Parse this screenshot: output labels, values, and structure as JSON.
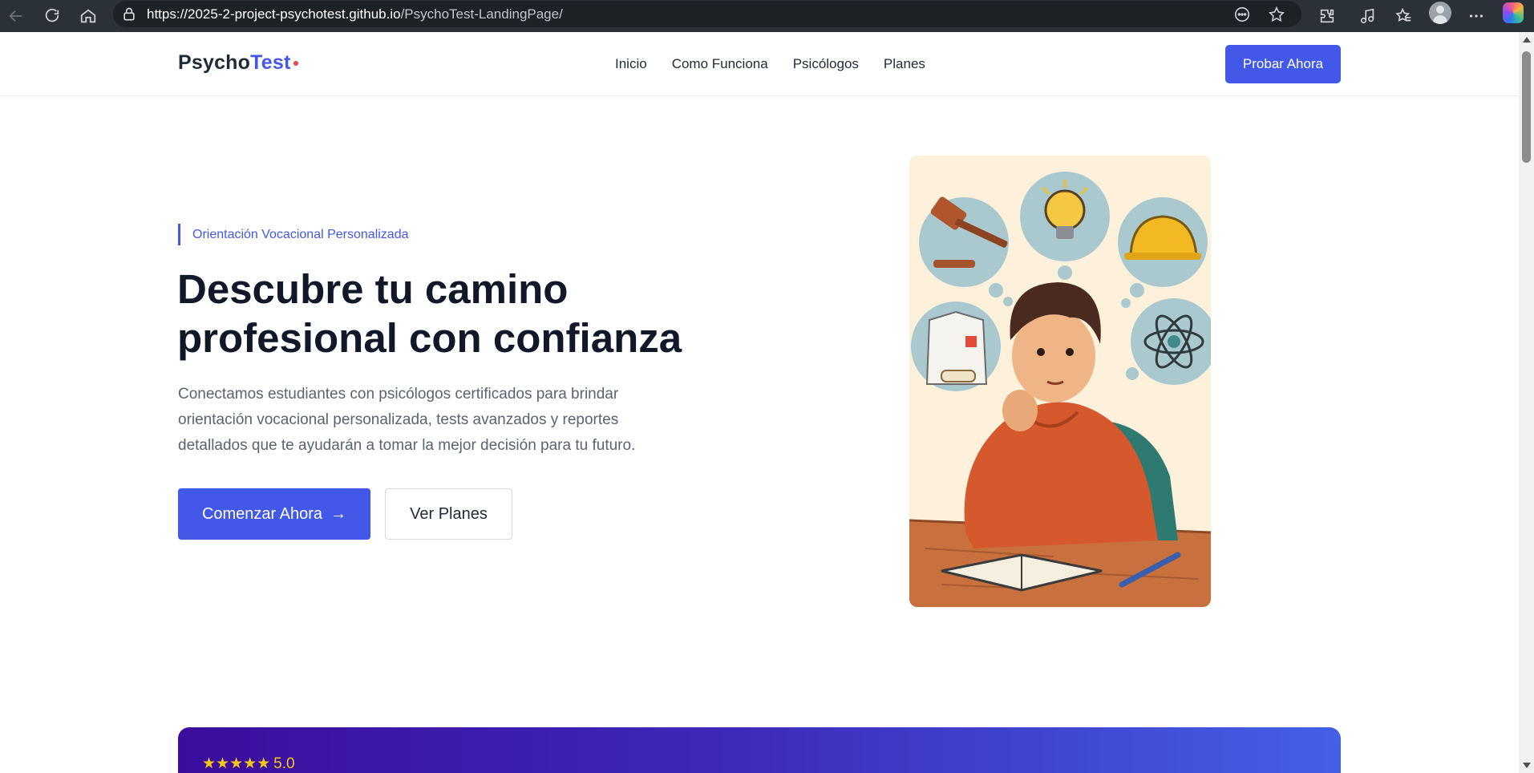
{
  "browser": {
    "url_host": "https://2025-2-project-psychotest.github.io",
    "url_path": "/PsychoTest-LandingPage/"
  },
  "header": {
    "logo_part1": "Psycho",
    "logo_part2": "Test",
    "nav": [
      "Inicio",
      "Como Funciona",
      "Psicólogos",
      "Planes"
    ],
    "cta_label": "Probar Ahora"
  },
  "hero": {
    "eyebrow": "Orientación Vocacional Personalizada",
    "title_line1": "Descubre tu camino",
    "title_line2": "profesional con confianza",
    "subtitle": "Conectamos estudiantes con psicólogos certificados para brindar orientación vocacional personalizada, tests avanzados y reportes detallados que te ayudarán a tomar la mejor decisión para tu futuro.",
    "primary_button": "Comenzar Ahora",
    "primary_button_arrow": "→",
    "secondary_button": "Ver Planes"
  },
  "banner": {
    "stars": "★★★★★",
    "rating": "5.0"
  },
  "colors": {
    "brand": "#4158e8",
    "logo_dot": "#ef4444",
    "banner_start": "#3b0d9c",
    "banner_end": "#4360e6"
  }
}
